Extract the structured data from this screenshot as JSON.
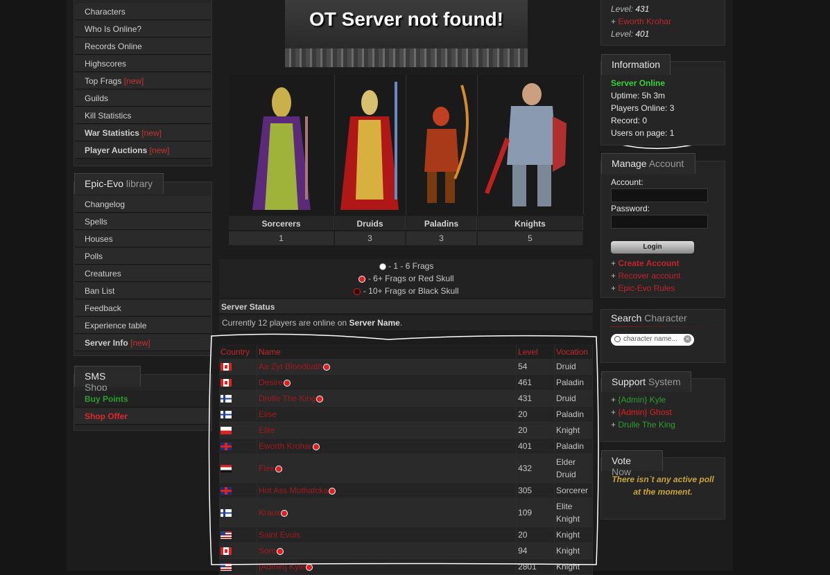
{
  "left_menu": {
    "items": [
      {
        "label": "Characters",
        "new": ""
      },
      {
        "label": "Who Is Online?",
        "new": ""
      },
      {
        "label": "Records Online",
        "new": ""
      },
      {
        "label": "Highscores",
        "new": ""
      },
      {
        "label": "Top Frags",
        "new": "[new]"
      },
      {
        "label": "Guilds",
        "new": ""
      },
      {
        "label": "Kill Statistics",
        "new": ""
      },
      {
        "label": "War Statistics",
        "new": "[new]"
      },
      {
        "label": "Player Auctions",
        "new": "[new]"
      }
    ],
    "library_title": "Epic-Evo",
    "library_title_thin": "library",
    "library_items": [
      {
        "label": "Changelog",
        "new": ""
      },
      {
        "label": "Spells",
        "new": ""
      },
      {
        "label": "Houses",
        "new": ""
      },
      {
        "label": "Polls",
        "new": ""
      },
      {
        "label": "Creatures",
        "new": ""
      },
      {
        "label": "Ban List",
        "new": ""
      },
      {
        "label": "Feedback",
        "new": ""
      },
      {
        "label": "Experience table",
        "new": ""
      },
      {
        "label": "Server Info",
        "new": "[new]"
      }
    ],
    "sms_title": "SMS",
    "sms_title_thin": "Shop",
    "buy_points": "Buy Points",
    "shop_offer": "Shop Offer"
  },
  "banner": {
    "text": "OT Server not found!"
  },
  "vocations": [
    {
      "name": "Sorcerers",
      "count": "1"
    },
    {
      "name": "Druids",
      "count": "3"
    },
    {
      "name": "Paladins",
      "count": "3"
    },
    {
      "name": "Knights",
      "count": "5"
    }
  ],
  "skull_legend": {
    "white": "- 1 - 6 Frags",
    "red": "- 6+ Frags or Red Skull",
    "black": "- 10+ Frags or Black Skull"
  },
  "server_status": {
    "title": "Server Status",
    "prefix": "Currently 12 players are online on ",
    "server_name": "Server Name",
    "suffix": "."
  },
  "online_table": {
    "headers": {
      "country": "Country",
      "name": "Name",
      "level": "Level",
      "vocation": "Vocation"
    },
    "rows": [
      {
        "flag": "ca",
        "name": "Aa Zyt Bloodbath",
        "skull": "red",
        "level": "54",
        "vocation": "Druid"
      },
      {
        "flag": "ca",
        "name": "Desire",
        "skull": "red",
        "level": "461",
        "vocation": "Paladin"
      },
      {
        "flag": "fi",
        "name": "Drulle The King",
        "skull": "red",
        "level": "431",
        "vocation": "Druid"
      },
      {
        "flag": "fi",
        "name": "Elise",
        "skull": "",
        "level": "20",
        "vocation": "Paladin"
      },
      {
        "flag": "pl",
        "name": "Elite",
        "skull": "",
        "level": "20",
        "vocation": "Knight"
      },
      {
        "flag": "gb",
        "name": "Eworth Krohar",
        "skull": "red",
        "level": "401",
        "vocation": "Paladin"
      },
      {
        "flag": "eg",
        "name": "Flex",
        "skull": "red",
        "level": "432",
        "vocation": "Elder Druid"
      },
      {
        "flag": "gb",
        "name": "Hot Ass Muthafcka",
        "skull": "red",
        "level": "305",
        "vocation": "Sorcerer"
      },
      {
        "flag": "fi",
        "name": "Kraux",
        "skull": "red",
        "level": "109",
        "vocation": "Elite Knight"
      },
      {
        "flag": "us",
        "name": "Saint Evuls",
        "skull": "",
        "level": "20",
        "vocation": "Knight"
      },
      {
        "flag": "ca",
        "name": "Soro",
        "skull": "red",
        "level": "94",
        "vocation": "Knight"
      },
      {
        "flag": "us",
        "name": "[Admin] Kyle",
        "skull": "red",
        "level": "2801",
        "vocation": "Knight"
      }
    ]
  },
  "right_top": {
    "level1_label": "Level:",
    "level1_value": "431",
    "plus": "+",
    "player2": "Eworth Krohar",
    "level2_label": "Level:",
    "level2_value": "401"
  },
  "information": {
    "title": "Information",
    "status": "Server Online",
    "uptime": "Uptime: 5h 3m",
    "players": "Players Online: 3",
    "record": "Record: 0",
    "users": "Users on page: 1"
  },
  "manage_account": {
    "title": "Manage",
    "title_thin": "Account",
    "account_label": "Account:",
    "password_label": "Password:",
    "login": "Login",
    "create": "Create Account",
    "recover": "Recover account",
    "rules": "Epic-Evo Rules"
  },
  "search_character": {
    "title": "Search",
    "title_thin": "Character",
    "placeholder": "character name..."
  },
  "support_system": {
    "title": "Support",
    "title_thin": "System",
    "members": [
      "{Admin} Kyle",
      "{Admin} Ghost",
      "Drulle The King"
    ]
  },
  "vote_now": {
    "title": "Vote",
    "title_thin": "Now",
    "message": "There isn`t any active poll at the moment."
  },
  "colors": {
    "accent_red": "#c0262b",
    "online_green": "#3bd13b",
    "gold": "#c9a53a"
  }
}
